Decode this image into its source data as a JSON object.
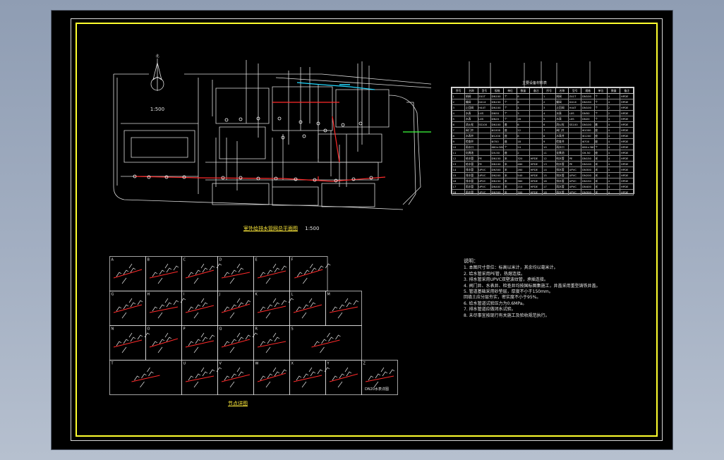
{
  "drawing": {
    "scale_label": "1:500",
    "plan_title": "室外给排水管网总平面图",
    "plan_scale": "1:500",
    "north_label": "北",
    "detail_title": "节点详图",
    "dn_label": "DN20水表详图",
    "table_title": "主要设备材料表",
    "detail_letters": [
      "A",
      "B",
      "C",
      "D",
      "E",
      "F",
      "G",
      "H",
      "I",
      "J",
      "K",
      "L",
      "M",
      "N",
      "O",
      "P",
      "Q",
      "R",
      "S",
      "T",
      "U",
      "V",
      "W",
      "X",
      "Y",
      "Z"
    ]
  },
  "table": {
    "header": [
      "序号",
      "名称",
      "型号",
      "规格",
      "单位",
      "数量",
      "备注",
      "序号",
      "名称",
      "型号",
      "规格",
      "单位",
      "数量",
      "备注"
    ],
    "rows": [
      [
        "1",
        "闸阀",
        "Z41T",
        "DN100",
        "个",
        "8",
        "",
        "1",
        "闸阀",
        "Z41T",
        "DN100",
        "个",
        "4",
        "HPDE"
      ],
      [
        "2",
        "蝶阀",
        "D41X",
        "DN150",
        "个",
        "6",
        "",
        "2",
        "蝶阀",
        "D41X",
        "DN150",
        "个",
        "4",
        "HPDE"
      ],
      [
        "3",
        "止回阀",
        "H44T",
        "DN100",
        "个",
        "4",
        "",
        "3",
        "止回阀",
        "H44T",
        "DN100",
        "个",
        "2",
        "HPDE"
      ],
      [
        "4",
        "水表",
        "LXS",
        "DN50",
        "个",
        "3",
        "",
        "4",
        "水表",
        "LXS",
        "DN50",
        "个",
        "2",
        "HPDE"
      ],
      [
        "5",
        "水表",
        "LXS",
        "DN20",
        "个",
        "26",
        "",
        "5",
        "水表",
        "LXS",
        "DN20",
        "个",
        "4",
        "HPDE"
      ],
      [
        "6",
        "消火栓",
        "SS100",
        "DN100",
        "套",
        "6",
        "",
        "6",
        "消火栓",
        "SS100",
        "DN100",
        "套",
        "4",
        "HPDE"
      ],
      [
        "7",
        "阀门井",
        "",
        "Φ1000",
        "座",
        "12",
        "",
        "7",
        "阀门井",
        "",
        "Φ1000",
        "座",
        "4",
        "HPDE"
      ],
      [
        "8",
        "水表井",
        "",
        "Φ1200",
        "座",
        "8",
        "",
        "8",
        "水表井",
        "",
        "Φ1200",
        "座",
        "4",
        "HPDE"
      ],
      [
        "9",
        "检查井",
        "",
        "Φ700",
        "座",
        "18",
        "",
        "9",
        "检查井",
        "",
        "Φ700",
        "座",
        "4",
        "HPDE"
      ],
      [
        "10",
        "雨水口",
        "",
        "680×380",
        "个",
        "24",
        "",
        "10",
        "雨水口",
        "",
        "680×380",
        "个",
        "4",
        "HPDE"
      ],
      [
        "11",
        "化粪池",
        "",
        "G9-50",
        "座",
        "2",
        "",
        "11",
        "化粪池",
        "",
        "G9-50",
        "座",
        "4",
        "HPDE"
      ],
      [
        "12",
        "给水管",
        "PE",
        "DN150",
        "米",
        "320",
        "HPDE",
        "12",
        "给水管",
        "PE",
        "DN150",
        "米",
        "4",
        "HPDE"
      ],
      [
        "13",
        "给水管",
        "PE",
        "DN100",
        "米",
        "480",
        "HPDE",
        "13",
        "给水管",
        "PE",
        "DN100",
        "米",
        "4",
        "HPDE"
      ],
      [
        "14",
        "排水管",
        "UPVC",
        "DN300",
        "米",
        "260",
        "HPDE",
        "14",
        "排水管",
        "UPVC",
        "DN300",
        "米",
        "4",
        "HPDE"
      ],
      [
        "15",
        "排水管",
        "UPVC",
        "DN200",
        "米",
        "540",
        "HPDE",
        "15",
        "排水管",
        "UPVC",
        "DN200",
        "米",
        "4",
        "HPDE"
      ],
      [
        "16",
        "排水管",
        "UPVC",
        "DN150",
        "米",
        "380",
        "HPDE",
        "16",
        "排水管",
        "UPVC",
        "DN150",
        "米",
        "4",
        "HPDE"
      ],
      [
        "17",
        "雨水管",
        "UPVC",
        "DN400",
        "米",
        "210",
        "HPDE",
        "17",
        "雨水管",
        "UPVC",
        "DN400",
        "米",
        "4",
        "HPDE"
      ],
      [
        "18",
        "雨水管",
        "UPVC",
        "DN300",
        "米",
        "300",
        "HPDE",
        "18",
        "雨水管",
        "UPVC",
        "DN300",
        "米",
        "4",
        "HPDE"
      ]
    ]
  },
  "notes": {
    "title": "说明：",
    "items": [
      "1. 本图尺寸单位：标高以米计，其余均以毫米计。",
      "2. 给水管采用PE管，热熔连接。",
      "3. 排水管采用UPVC双壁波纹管，承插连接。",
      "4. 阀门井、水表井、检查井均按国标图集施工，井盖采用重型铸铁井盖。",
      "5. 管道基础采用砂垫层，厚度不小于150mm。",
      "   回填土应分层夯实，密实度不小于95%。",
      "6. 给水管道试验压力为0.6MPa。",
      "7. 排水管道应做闭水试验。",
      "8. 未尽事宜按现行有关施工及验收规范执行。"
    ]
  },
  "colors": {
    "background": "#000000",
    "frame": "#ffff2e",
    "linework": "#ffffff",
    "pipe_red": "#ff2a2a",
    "pipe_cyan": "#22d8ff",
    "pipe_green": "#3cff3c"
  }
}
